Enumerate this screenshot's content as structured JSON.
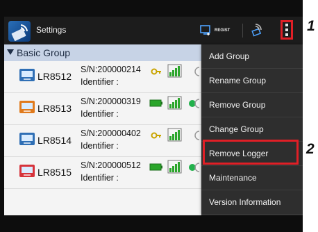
{
  "app": {
    "title": "Settings"
  },
  "toolbar": {
    "regist_label": "REGIST"
  },
  "group": {
    "name": "Basic Group"
  },
  "loggers": [
    {
      "model": "LR8512",
      "sn": "S/N:200000214",
      "identifier": "Identifier :",
      "icon_color": "#2f6fb5",
      "status": "key",
      "dot": false
    },
    {
      "model": "LR8513",
      "sn": "S/N:200000319",
      "identifier": "Identifier :",
      "icon_color": "#e07a1c",
      "status": "battery",
      "dot": true
    },
    {
      "model": "LR8514",
      "sn": "S/N:200000402",
      "identifier": "Identifier :",
      "icon_color": "#2f6fb5",
      "status": "key",
      "dot": false
    },
    {
      "model": "LR8515",
      "sn": "S/N:200000512",
      "identifier": "Identifier :",
      "icon_color": "#d6333b",
      "status": "battery",
      "dot": true
    }
  ],
  "menu": {
    "items": [
      "Add Group",
      "Rename Group",
      "Remove Group",
      "Change Group",
      "Remove Logger",
      "Maintenance",
      "Version Information"
    ],
    "highlighted": "Remove Logger"
  },
  "callouts": {
    "one": "1",
    "two": "2"
  },
  "colors": {
    "highlight": "#e01f26",
    "menu_bg": "#2e2e2e",
    "group_bg": "#c7d3e6",
    "actionbar_bg": "#1c1c1c"
  },
  "icons": {
    "app": "loggers-app-icon",
    "regist": "regist-icon",
    "wireless": "wireless-icon",
    "overflow": "overflow-menu-icon",
    "key": "key-icon",
    "battery": "battery-icon",
    "signal": "signal-icon"
  }
}
